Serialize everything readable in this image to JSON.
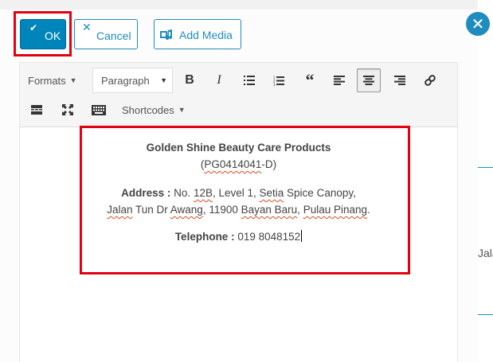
{
  "background": {
    "right_fragment": "Jala"
  },
  "dialog": {
    "ok_label": "OK",
    "cancel_label": "Cancel",
    "add_media_label": "Add Media"
  },
  "toolbar": {
    "formats_label": "Formats",
    "paragraph_label": "Paragraph",
    "shortcodes_label": "Shortcodes",
    "icons": [
      "bold-icon",
      "italic-icon",
      "bullet-list-icon",
      "numbered-list-icon",
      "blockquote-icon",
      "align-left-icon",
      "align-center-icon",
      "align-right-icon",
      "link-icon",
      "read-more-icon",
      "fullscreen-icon",
      "keyboard-icon"
    ],
    "active_icon": "align-center-icon"
  },
  "content": {
    "company_name": "Golden Shine Beauty Care Products",
    "reg_open": "(",
    "reg_number": "PG0414041",
    "reg_suffix": "-D)",
    "address_label": "Address :",
    "address_line1_a": " No. ",
    "address_12b": "12B",
    "address_line1_b": ", Level 1, ",
    "address_setia": "Setia",
    "address_line1_c": " Spice Canopy,",
    "address_jalan": "Jalan",
    "address_line2_a": " Tun Dr ",
    "address_awang": "Awang",
    "address_line2_b": ", 11900 ",
    "address_bayan_baru": "Bayan Baru",
    "address_line2_c": ", ",
    "address_pulau_pinang": "Pulau Pinang",
    "address_line2_d": ".",
    "telephone_label": "Telephone :",
    "telephone_value": " 019 8048152"
  },
  "colors": {
    "accent": "#0085ba",
    "highlight": "#e3000f",
    "close": "#1e8cbe"
  }
}
